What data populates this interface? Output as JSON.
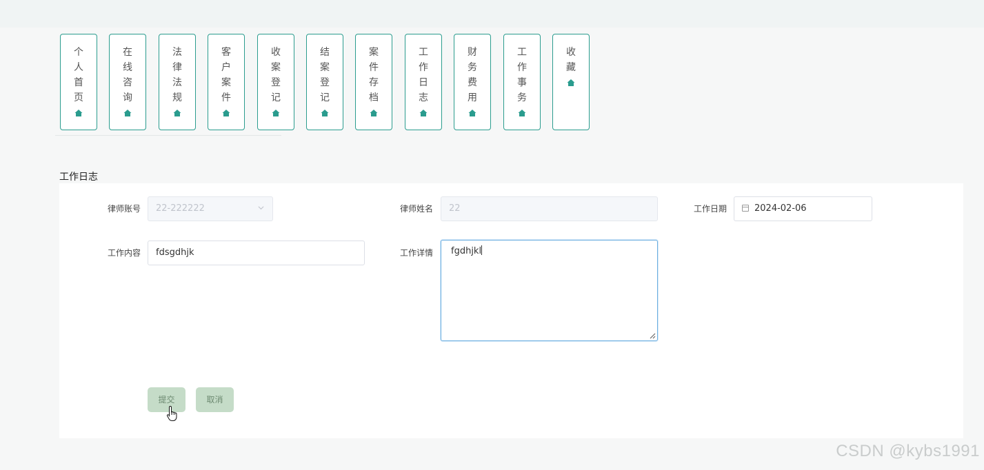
{
  "nav": {
    "items": [
      {
        "label": "个人首页",
        "chars": [
          "个",
          "人",
          "首",
          "页"
        ],
        "icon": "home-icon"
      },
      {
        "label": "在线咨询",
        "chars": [
          "在",
          "线",
          "咨",
          "询"
        ],
        "icon": "home-icon"
      },
      {
        "label": "法律法规",
        "chars": [
          "法",
          "律",
          "法",
          "规"
        ],
        "icon": "home-icon"
      },
      {
        "label": "客户案件",
        "chars": [
          "客",
          "户",
          "案",
          "件"
        ],
        "icon": "home-icon"
      },
      {
        "label": "收案登记",
        "chars": [
          "收",
          "案",
          "登",
          "记"
        ],
        "icon": "home-icon"
      },
      {
        "label": "结案登记",
        "chars": [
          "结",
          "案",
          "登",
          "记"
        ],
        "icon": "home-icon"
      },
      {
        "label": "案件存档",
        "chars": [
          "案",
          "件",
          "存",
          "档"
        ],
        "icon": "home-icon"
      },
      {
        "label": "工作日志",
        "chars": [
          "工",
          "作",
          "日",
          "志"
        ],
        "icon": "home-icon"
      },
      {
        "label": "财务费用",
        "chars": [
          "财",
          "务",
          "费",
          "用"
        ],
        "icon": "home-icon"
      },
      {
        "label": "工作事务",
        "chars": [
          "工",
          "作",
          "事",
          "务"
        ],
        "icon": "home-icon"
      },
      {
        "label": "收藏",
        "chars": [
          "收",
          "藏"
        ],
        "icon": "home-icon"
      }
    ],
    "accent_color": "#2a9c8e"
  },
  "section_title": "工作日志",
  "form": {
    "lawyer_account": {
      "label": "律师账号",
      "value": "22-222222"
    },
    "lawyer_name": {
      "label": "律师姓名",
      "value": "22"
    },
    "work_date": {
      "label": "工作日期",
      "value": "2024-02-06"
    },
    "work_content": {
      "label": "工作内容",
      "value": "fdsgdhjk"
    },
    "work_detail": {
      "label": "工作详情",
      "value": "fgdhjkl"
    }
  },
  "buttons": {
    "submit": "提交",
    "cancel": "取消",
    "color": "#c5dcc8"
  },
  "watermark": "CSDN @kybs1991"
}
